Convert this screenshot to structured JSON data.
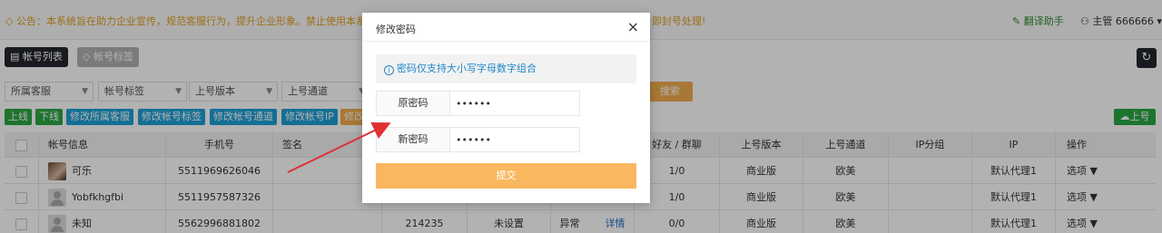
{
  "notice": {
    "text": "◇ 公告：本系统旨在助力企业宣传，规范客服行为，提升企业形象。禁止使用本系统",
    "tail": "即封号处理!"
  },
  "header": {
    "translate_label": "翻译助手",
    "user_label": "主管 666666"
  },
  "tabs": [
    {
      "label": "帐号列表"
    },
    {
      "label": "帐号标签"
    }
  ],
  "filters": [
    {
      "label": "所属客服"
    },
    {
      "label": "帐号标签"
    },
    {
      "label": "上号版本"
    },
    {
      "label": "上号通道"
    }
  ],
  "search_label": "搜索",
  "actions": [
    {
      "label": "上线"
    },
    {
      "label": "下线"
    },
    {
      "label": "修改所属客服"
    },
    {
      "label": "修改帐号标签"
    },
    {
      "label": "修改帐号通道"
    },
    {
      "label": "修改帐号IP"
    },
    {
      "label": "修改"
    }
  ],
  "upload_label": "上号",
  "table": {
    "headers": {
      "account": "帐号信息",
      "phone": "手机号",
      "sign": "签名",
      "friends": "好友 / 群聊",
      "version": "上号版本",
      "channel": "上号通道",
      "ip_group": "IP分组",
      "ip": "IP",
      "ops": "操作"
    },
    "rows": [
      {
        "name": "可乐",
        "phone": "5511969626046",
        "extra": "",
        "status": "",
        "state": "",
        "detail": "",
        "friends": "1/0",
        "version": "商业版",
        "channel": "欧美",
        "ip": "默认代理1",
        "op": "选项"
      },
      {
        "name": "Yobfkhgfbi",
        "phone": "5511957587326",
        "extra": "",
        "status": "",
        "state": "",
        "detail": "",
        "friends": "1/0",
        "version": "商业版",
        "channel": "欧美",
        "ip": "默认代理1",
        "op": "选项"
      },
      {
        "name": "未知",
        "phone": "5562996881802",
        "extra": "214235",
        "status": "未设置",
        "state": "异常",
        "detail": "详情",
        "friends": "0/0",
        "version": "商业版",
        "channel": "欧美",
        "ip": "默认代理1",
        "op": "选项"
      }
    ]
  },
  "modal": {
    "title": "修改密码",
    "close": "×",
    "tip": "密码仅支持大小写字母数字组合",
    "old_label": "原密码",
    "old_value": "••••••",
    "new_label": "新密码",
    "new_value": "••••••",
    "submit": "提交"
  },
  "colors": {
    "accent_orange": "#f9b85f",
    "tip_blue": "#1e88c8",
    "arrow_red": "#e03030"
  }
}
